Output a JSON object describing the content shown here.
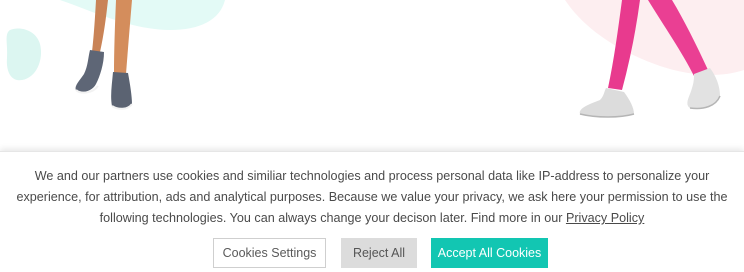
{
  "consent": {
    "text_main": "We and our partners use cookies and similiar technologies and process personal data like IP-address to personalize your experience, for attribution, ads and analytical purposes. Because we value your privacy, we ask here your permission to use the following technologies. You can always change your decison later. Find more in our ",
    "privacy_link": "Privacy Policy",
    "buttons": {
      "settings": "Cookies Settings",
      "reject": "Reject All",
      "accept": "Accept All Cookies"
    }
  },
  "colors": {
    "accent": "#12c6b2",
    "reject_bg": "#dcdcdc",
    "text": "#4a4a4a"
  }
}
